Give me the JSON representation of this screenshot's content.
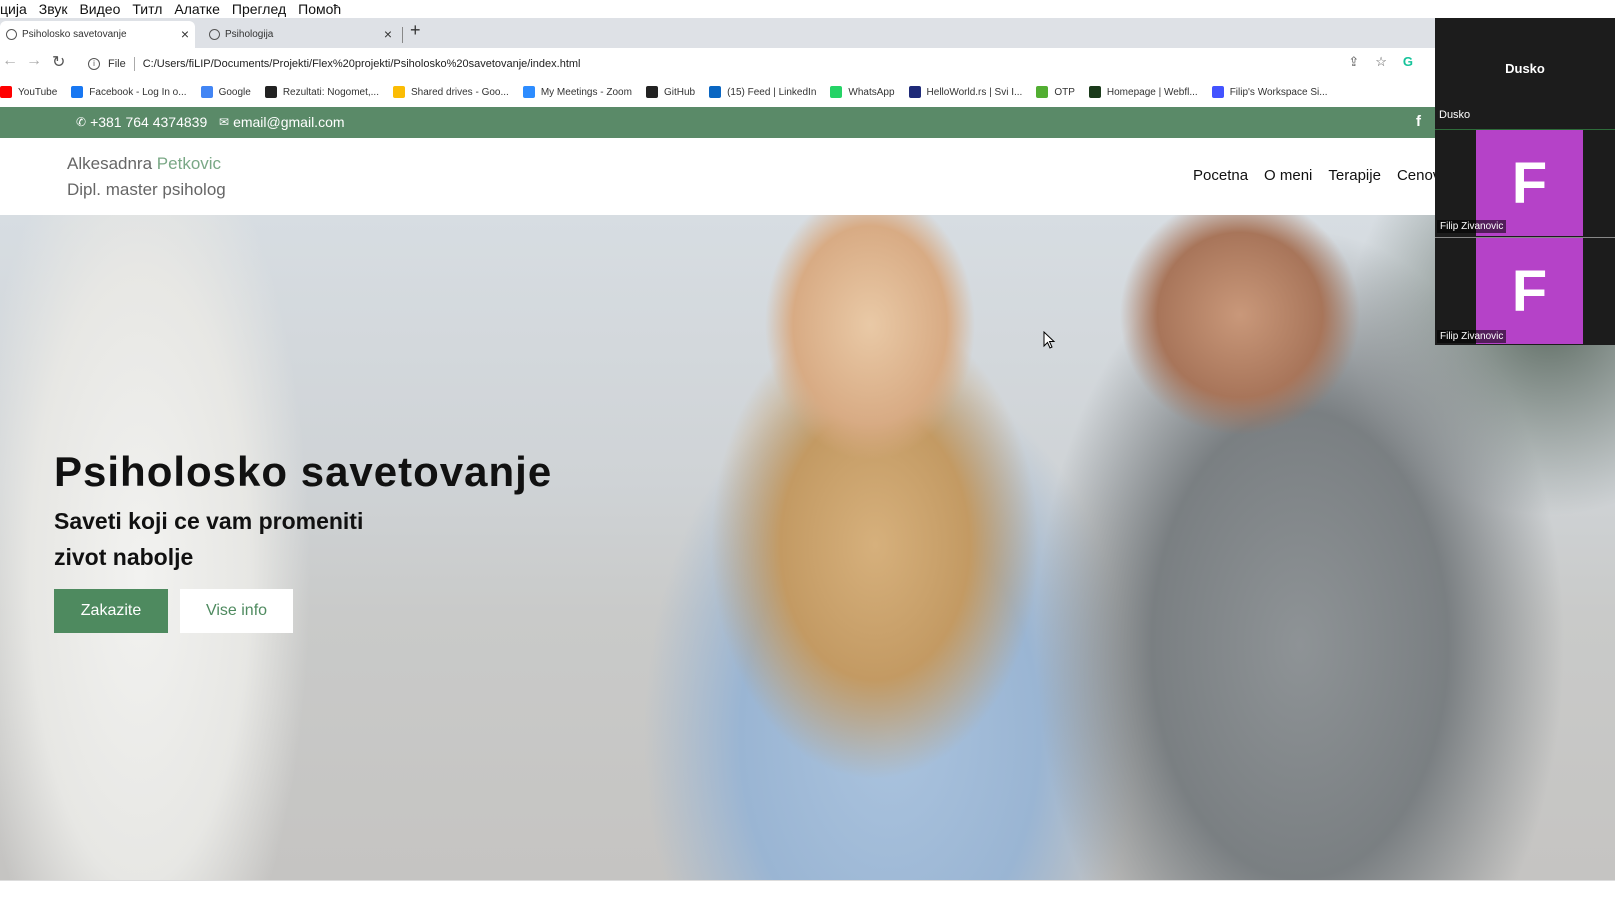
{
  "menubar": {
    "items": [
      "ција",
      "Звук",
      "Видео",
      "Титл",
      "Алатке",
      "Преглед",
      "Помоћ"
    ]
  },
  "browser": {
    "tabs": [
      {
        "label": "Psiholosko savetovanje",
        "active": true
      },
      {
        "label": "Psihologija",
        "active": false
      }
    ],
    "address": {
      "scheme_label": "File",
      "url": "C:/Users/fiLIP/Documents/Projekti/Flex%20projekti/Psiholosko%20savetovanje/index.html"
    },
    "bookmarks": [
      {
        "label": "YouTube",
        "icon": "youtube-icon",
        "color": "#ff0000"
      },
      {
        "label": "Facebook - Log In o...",
        "icon": "facebook-icon",
        "color": "#1877f2"
      },
      {
        "label": "Google",
        "icon": "google-icon",
        "color": "#4285f4"
      },
      {
        "label": "Rezultati: Nogomet,...",
        "icon": "flashscore-icon",
        "color": "#222222"
      },
      {
        "label": "Shared drives - Goo...",
        "icon": "google-drive-icon",
        "color": "#fbbc04"
      },
      {
        "label": "My Meetings - Zoom",
        "icon": "zoom-icon",
        "color": "#2d8cff"
      },
      {
        "label": "GitHub",
        "icon": "github-icon",
        "color": "#222222"
      },
      {
        "label": "(15) Feed | LinkedIn",
        "icon": "linkedin-icon",
        "color": "#0a66c2"
      },
      {
        "label": "WhatsApp",
        "icon": "whatsapp-icon",
        "color": "#25d366"
      },
      {
        "label": "HelloWorld.rs | Svi I...",
        "icon": "helloworld-icon",
        "color": "#1e2a78"
      },
      {
        "label": "OTP",
        "icon": "otp-icon",
        "color": "#52ae32"
      },
      {
        "label": "Homepage | Webfl...",
        "icon": "webflow-icon",
        "color": "#1a3a1a"
      },
      {
        "label": "Filip's Workspace Si...",
        "icon": "workspace-icon",
        "color": "#4353ff"
      }
    ]
  },
  "site": {
    "topbar": {
      "phone": "+381 764 4374839",
      "email": "email@gmail.com",
      "social": "f"
    },
    "logo": {
      "first_name": "Alkesadnra",
      "last_name": "Petkovic",
      "subtitle": "Dipl. master psiholog"
    },
    "nav": [
      "Pocetna",
      "O meni",
      "Terapije",
      "Cenov"
    ],
    "hero": {
      "title": "Psiholosko savetovanje",
      "subtitle_line1": "Saveti koji ce vam promeniti",
      "subtitle_line2": "zivot nabolje",
      "primary_button": "Zakazite",
      "secondary_button": "Vise info"
    },
    "colors": {
      "accent": "#5a8a68",
      "button": "#4e8a5f"
    }
  },
  "zoom_panel": {
    "participants": [
      {
        "name": "Dusko",
        "label": "Dusko",
        "avatar": ""
      },
      {
        "name": "Filip Zivanovic",
        "label": "Filip Zivanovic",
        "avatar": "F",
        "avatar_color": "#b542c8"
      },
      {
        "name": "Filip Zivanovic",
        "label": "Filip Zivanovic",
        "avatar": "F",
        "avatar_color": "#b542c8"
      }
    ]
  }
}
